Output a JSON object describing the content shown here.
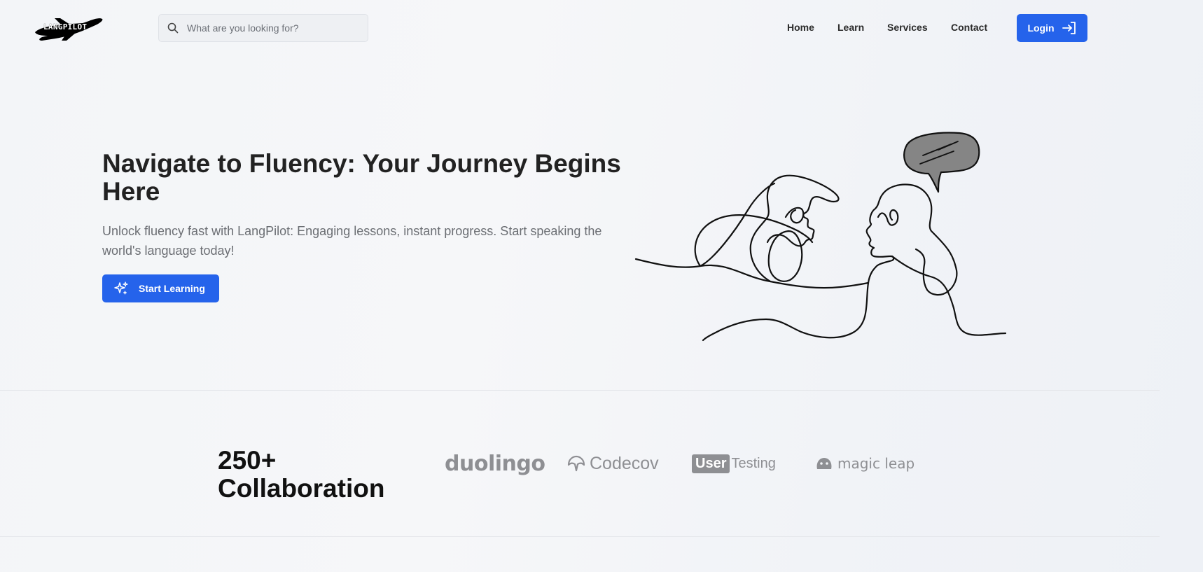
{
  "header": {
    "logo_text": "LANGPILOT",
    "search": {
      "placeholder": "What are you looking for?"
    },
    "nav": [
      {
        "label": "Home"
      },
      {
        "label": "Learn"
      },
      {
        "label": "Services"
      },
      {
        "label": "Contact"
      }
    ],
    "login_label": "Login"
  },
  "hero": {
    "title": "Navigate to Fluency: Your Journey Begins Here",
    "subtitle": "Unlock fluency fast with LangPilot: Engaging lessons, instant progress. Start speaking the world's language today!",
    "cta_label": "Start Learning"
  },
  "collab": {
    "count": "250+",
    "label": "Collaboration",
    "brands": {
      "duolingo": "duolingo",
      "codecov": "Codecov",
      "usertesting_box": "User",
      "usertesting_rest": "Testing",
      "magicleap": "magic leap"
    }
  },
  "colors": {
    "accent": "#2563eb",
    "heading": "#222222",
    "muted": "#6b6e73",
    "brand_gray": "#8e8f93"
  },
  "icons": [
    "search-icon",
    "login-arrow-icon",
    "sparkles-icon",
    "airplane-logo",
    "codecov-umbrella-icon",
    "magicleap-face-icon"
  ]
}
